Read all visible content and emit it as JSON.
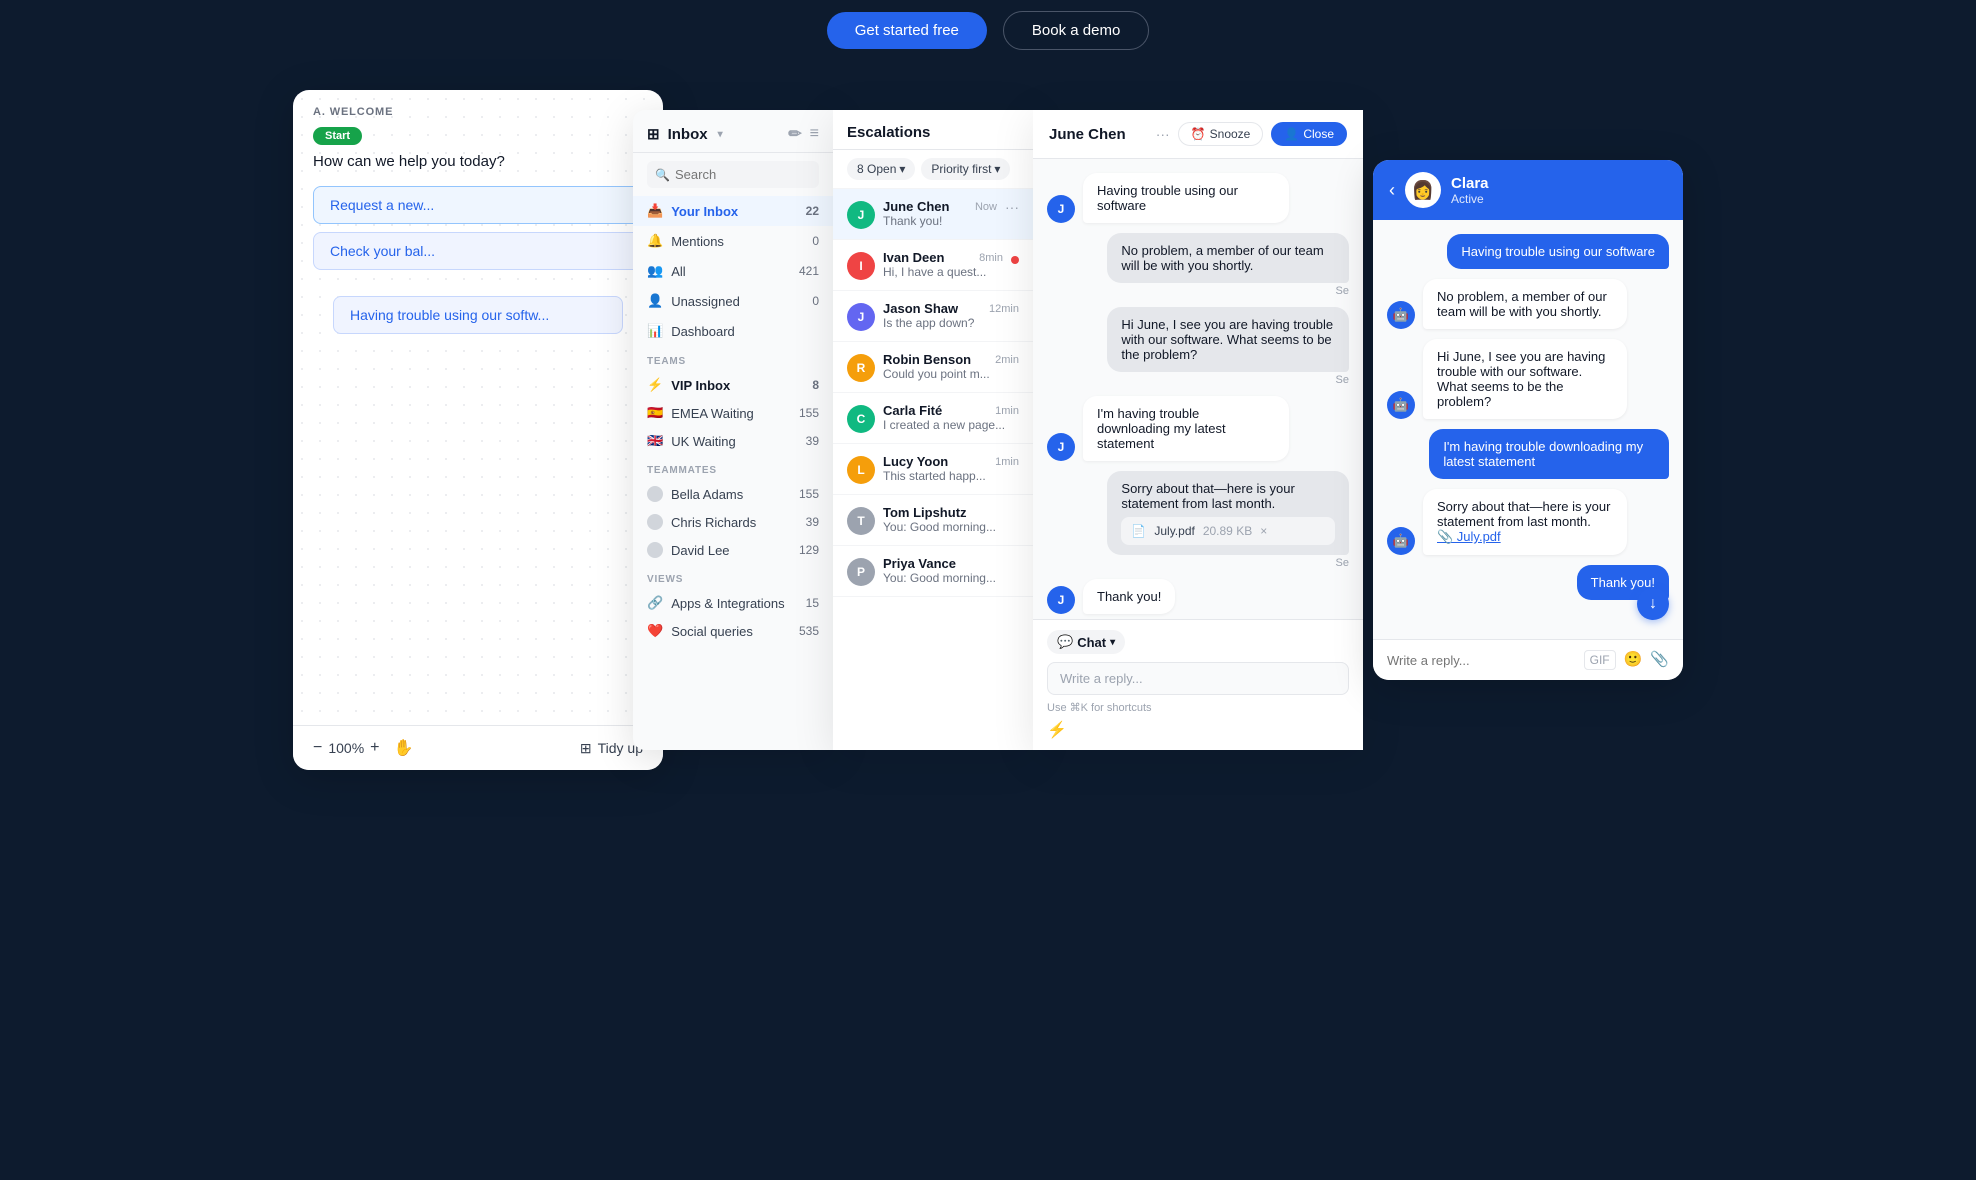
{
  "topbar": {
    "btn1_label": "Get started free",
    "btn2_label": "Book a demo"
  },
  "flow": {
    "section_label": "A. WELCOME",
    "start_badge": "Start",
    "question": "How can we help you today?",
    "option1": "Request a new...",
    "option2": "Check your bal...",
    "option3": "Having trouble using our softw...",
    "footer_zoom": "100%",
    "footer_tidy": "Tidy up",
    "zoom_minus": "−",
    "zoom_plus": "+"
  },
  "inbox": {
    "title": "Inbox",
    "search_placeholder": "Search",
    "nav": [
      {
        "label": "Your Inbox",
        "count": "22",
        "icon": "📥"
      },
      {
        "label": "Mentions",
        "count": "0",
        "icon": "🔔"
      },
      {
        "label": "All",
        "count": "421",
        "icon": "👥"
      },
      {
        "label": "Unassigned",
        "count": "0",
        "icon": "👤"
      },
      {
        "label": "Dashboard",
        "count": "",
        "icon": "📊"
      }
    ],
    "teams_label": "TEAMS",
    "teams": [
      {
        "label": "VIP Inbox",
        "count": "8",
        "flag": "⚡",
        "highlight": true
      },
      {
        "label": "EMEA Waiting",
        "count": "155",
        "flag": "🇪🇸"
      },
      {
        "label": "UK Waiting",
        "count": "39",
        "flag": "🇬🇧"
      }
    ],
    "teammates_label": "TEAMMATES",
    "teammates": [
      {
        "label": "Bella Adams",
        "count": "155"
      },
      {
        "label": "Chris Richards",
        "count": "39"
      },
      {
        "label": "David Lee",
        "count": "129"
      }
    ],
    "views_label": "VIEWS",
    "views": [
      {
        "label": "Apps & Integrations",
        "count": "15",
        "icon": "🔗"
      },
      {
        "label": "Social queries",
        "count": "535",
        "icon": "❤️"
      }
    ]
  },
  "conversations": {
    "title": "Escalations",
    "filter_open": "8 Open",
    "filter_priority": "Priority first",
    "items": [
      {
        "name": "June Chen",
        "preview": "Thank you!",
        "time": "Now",
        "color": "#10b981",
        "priority": false,
        "active": true
      },
      {
        "name": "Ivan Deen",
        "preview": "Hi, I have a quest...",
        "time": "8min",
        "color": "#ef4444",
        "priority": true
      },
      {
        "name": "Jason Shaw",
        "preview": "Is the app down?",
        "time": "12min",
        "color": "#6366f1",
        "priority": false
      },
      {
        "name": "Robin Benson",
        "preview": "Could you point m...",
        "time": "2min",
        "color": "#f59e0b",
        "priority": false
      },
      {
        "name": "Carla Fité",
        "preview": "I created a new page...",
        "time": "1min",
        "color": "#10b981",
        "priority": false
      },
      {
        "name": "Lucy Yoon",
        "preview": "This started happ...",
        "time": "1min",
        "color": "#f59e0b",
        "priority": false
      },
      {
        "name": "Tom Lipshutz",
        "preview": "You: Good morning...",
        "time": "",
        "color": "#9ca3af",
        "priority": false
      },
      {
        "name": "Priya Vance",
        "preview": "You: Good morning...",
        "time": "",
        "color": "#9ca3af",
        "priority": false
      }
    ]
  },
  "chat": {
    "contact_name": "June Chen",
    "snooze_label": "Snooze",
    "close_label": "Close",
    "more_icon": "···",
    "messages": [
      {
        "type": "user",
        "text": "Having trouble using our software",
        "avatar": "J"
      },
      {
        "type": "agent",
        "text": "No problem, a member of our team will be with you shortly."
      },
      {
        "type": "agent",
        "text": "Hi June, I see you are having trouble with our software. What seems to be the problem?"
      },
      {
        "type": "user",
        "text": "I'm having trouble downloading my latest statement",
        "avatar": "J"
      },
      {
        "type": "agent",
        "text": "Sorry about that—here is your statement from last month.",
        "attachment": {
          "name": "July.pdf",
          "size": "20.89 KB"
        }
      },
      {
        "type": "user",
        "text": "Thank you!",
        "avatar": "J"
      }
    ],
    "seen_label": "Se",
    "tab_chat": "Chat",
    "tab_icon": "💬",
    "input_placeholder": "Write a reply...",
    "shortcuts_hint": "Use ⌘K for shortcuts",
    "lightning": "⚡"
  },
  "clara": {
    "header_name": "Clara",
    "header_status": "Active",
    "back_icon": "‹",
    "avatar_emoji": "👩",
    "messages": [
      {
        "type": "right",
        "text": "Having trouble using our software"
      },
      {
        "type": "left",
        "text": "No problem, a member of our team will be with you shortly."
      },
      {
        "type": "left",
        "text": "Hi June, I see you are having trouble with our software. What seems to be the problem?"
      },
      {
        "type": "right",
        "text": "I'm having trouble downloading my latest statement"
      },
      {
        "type": "left_with_link",
        "text": "Sorry about that—here is your statement from last month.",
        "link_text": "📎 July.pdf"
      },
      {
        "type": "right",
        "text": "Thank you!"
      }
    ],
    "input_placeholder": "Write a reply...",
    "gif_label": "GIF",
    "scroll_icon": "↓"
  }
}
